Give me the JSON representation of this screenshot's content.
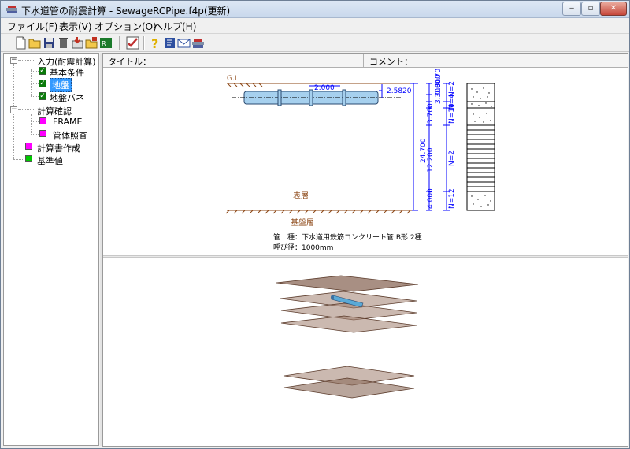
{
  "window": {
    "title": "下水道管の耐震計算 - SewageRCPipe.f4p(更新)",
    "controls": {
      "minimize": "‒",
      "maximize": "▫",
      "close": "✕"
    }
  },
  "menu": [
    {
      "label": "ファイル(F)"
    },
    {
      "label": "表示(V)"
    },
    {
      "label": "オプション(O)"
    },
    {
      "label": "ヘルプ(H)"
    }
  ],
  "toolbar": [
    "new-file-icon",
    "open-folder-icon",
    "save-icon",
    "delete-icon",
    "import-icon",
    "export-icon",
    "calc-report-icon",
    "check-icon",
    "help-icon",
    "manual-icon",
    "email-icon",
    "about-icon"
  ],
  "tree": {
    "nodes": [
      {
        "label": "入力(耐震計算)"
      },
      {
        "label": "基本条件"
      },
      {
        "label": "地盤",
        "selected": true
      },
      {
        "label": "地盤バネ"
      },
      {
        "label": "計算確認"
      },
      {
        "label": "FRAME"
      },
      {
        "label": "管体照査"
      },
      {
        "label": "計算書作成"
      },
      {
        "label": "基準値"
      }
    ],
    "colors": {
      "check": "#0a7a0a",
      "magenta": "#ff00ff",
      "green": "#00c800",
      "selected_bg": "#3399ff"
    }
  },
  "info": {
    "title_label": "タイトル：",
    "comment_label": "コメント："
  },
  "drawing": {
    "gl_label": "G.L",
    "cover_depth": "2.000",
    "pipe_offset": "2.5820",
    "total_depth": "24.700",
    "dims_top": [
      "3.300",
      "0.800",
      "0.700",
      "3.700"
    ],
    "dims_mid": "12.200",
    "dims_bot": "4.000",
    "n_labels": [
      "N=2",
      "N=4",
      "N=10",
      "N=2",
      "N=12"
    ],
    "surface_layer": "表層",
    "base_layer": "基盤層",
    "pipe_type": "管　種：下水道用鉄筋コンクリート管 B形 2種",
    "nominal_diameter": "呼び径：1000mm",
    "colors": {
      "ground_line": "#8b4513",
      "dimension": "#0000ff",
      "pipe": "#a6d0ee",
      "layer_text": "#8b4513"
    }
  }
}
